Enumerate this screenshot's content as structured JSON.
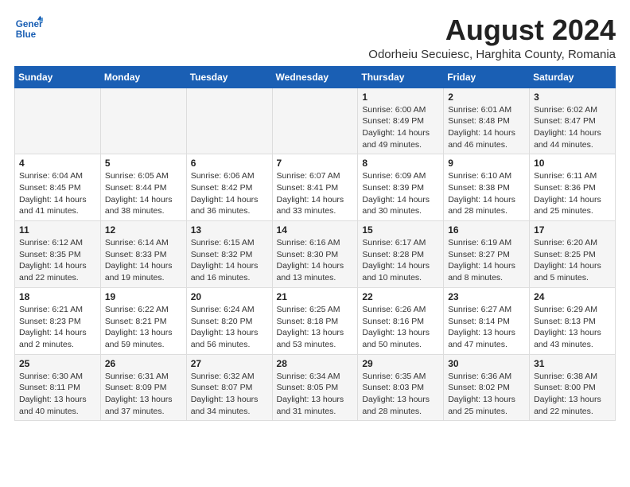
{
  "logo": {
    "line1": "General",
    "line2": "Blue"
  },
  "title": "August 2024",
  "subtitle": "Odorheiu Secuiesc, Harghita County, Romania",
  "weekdays": [
    "Sunday",
    "Monday",
    "Tuesday",
    "Wednesday",
    "Thursday",
    "Friday",
    "Saturday"
  ],
  "weeks": [
    [
      {
        "day": "",
        "info": ""
      },
      {
        "day": "",
        "info": ""
      },
      {
        "day": "",
        "info": ""
      },
      {
        "day": "",
        "info": ""
      },
      {
        "day": "1",
        "info": "Sunrise: 6:00 AM\nSunset: 8:49 PM\nDaylight: 14 hours\nand 49 minutes."
      },
      {
        "day": "2",
        "info": "Sunrise: 6:01 AM\nSunset: 8:48 PM\nDaylight: 14 hours\nand 46 minutes."
      },
      {
        "day": "3",
        "info": "Sunrise: 6:02 AM\nSunset: 8:47 PM\nDaylight: 14 hours\nand 44 minutes."
      }
    ],
    [
      {
        "day": "4",
        "info": "Sunrise: 6:04 AM\nSunset: 8:45 PM\nDaylight: 14 hours\nand 41 minutes."
      },
      {
        "day": "5",
        "info": "Sunrise: 6:05 AM\nSunset: 8:44 PM\nDaylight: 14 hours\nand 38 minutes."
      },
      {
        "day": "6",
        "info": "Sunrise: 6:06 AM\nSunset: 8:42 PM\nDaylight: 14 hours\nand 36 minutes."
      },
      {
        "day": "7",
        "info": "Sunrise: 6:07 AM\nSunset: 8:41 PM\nDaylight: 14 hours\nand 33 minutes."
      },
      {
        "day": "8",
        "info": "Sunrise: 6:09 AM\nSunset: 8:39 PM\nDaylight: 14 hours\nand 30 minutes."
      },
      {
        "day": "9",
        "info": "Sunrise: 6:10 AM\nSunset: 8:38 PM\nDaylight: 14 hours\nand 28 minutes."
      },
      {
        "day": "10",
        "info": "Sunrise: 6:11 AM\nSunset: 8:36 PM\nDaylight: 14 hours\nand 25 minutes."
      }
    ],
    [
      {
        "day": "11",
        "info": "Sunrise: 6:12 AM\nSunset: 8:35 PM\nDaylight: 14 hours\nand 22 minutes."
      },
      {
        "day": "12",
        "info": "Sunrise: 6:14 AM\nSunset: 8:33 PM\nDaylight: 14 hours\nand 19 minutes."
      },
      {
        "day": "13",
        "info": "Sunrise: 6:15 AM\nSunset: 8:32 PM\nDaylight: 14 hours\nand 16 minutes."
      },
      {
        "day": "14",
        "info": "Sunrise: 6:16 AM\nSunset: 8:30 PM\nDaylight: 14 hours\nand 13 minutes."
      },
      {
        "day": "15",
        "info": "Sunrise: 6:17 AM\nSunset: 8:28 PM\nDaylight: 14 hours\nand 10 minutes."
      },
      {
        "day": "16",
        "info": "Sunrise: 6:19 AM\nSunset: 8:27 PM\nDaylight: 14 hours\nand 8 minutes."
      },
      {
        "day": "17",
        "info": "Sunrise: 6:20 AM\nSunset: 8:25 PM\nDaylight: 14 hours\nand 5 minutes."
      }
    ],
    [
      {
        "day": "18",
        "info": "Sunrise: 6:21 AM\nSunset: 8:23 PM\nDaylight: 14 hours\nand 2 minutes."
      },
      {
        "day": "19",
        "info": "Sunrise: 6:22 AM\nSunset: 8:21 PM\nDaylight: 13 hours\nand 59 minutes."
      },
      {
        "day": "20",
        "info": "Sunrise: 6:24 AM\nSunset: 8:20 PM\nDaylight: 13 hours\nand 56 minutes."
      },
      {
        "day": "21",
        "info": "Sunrise: 6:25 AM\nSunset: 8:18 PM\nDaylight: 13 hours\nand 53 minutes."
      },
      {
        "day": "22",
        "info": "Sunrise: 6:26 AM\nSunset: 8:16 PM\nDaylight: 13 hours\nand 50 minutes."
      },
      {
        "day": "23",
        "info": "Sunrise: 6:27 AM\nSunset: 8:14 PM\nDaylight: 13 hours\nand 47 minutes."
      },
      {
        "day": "24",
        "info": "Sunrise: 6:29 AM\nSunset: 8:13 PM\nDaylight: 13 hours\nand 43 minutes."
      }
    ],
    [
      {
        "day": "25",
        "info": "Sunrise: 6:30 AM\nSunset: 8:11 PM\nDaylight: 13 hours\nand 40 minutes."
      },
      {
        "day": "26",
        "info": "Sunrise: 6:31 AM\nSunset: 8:09 PM\nDaylight: 13 hours\nand 37 minutes."
      },
      {
        "day": "27",
        "info": "Sunrise: 6:32 AM\nSunset: 8:07 PM\nDaylight: 13 hours\nand 34 minutes."
      },
      {
        "day": "28",
        "info": "Sunrise: 6:34 AM\nSunset: 8:05 PM\nDaylight: 13 hours\nand 31 minutes."
      },
      {
        "day": "29",
        "info": "Sunrise: 6:35 AM\nSunset: 8:03 PM\nDaylight: 13 hours\nand 28 minutes."
      },
      {
        "day": "30",
        "info": "Sunrise: 6:36 AM\nSunset: 8:02 PM\nDaylight: 13 hours\nand 25 minutes."
      },
      {
        "day": "31",
        "info": "Sunrise: 6:38 AM\nSunset: 8:00 PM\nDaylight: 13 hours\nand 22 minutes."
      }
    ]
  ],
  "colors": {
    "header_bg": "#1a5fb4",
    "odd_row": "#f5f5f5",
    "even_row": "#ffffff"
  }
}
